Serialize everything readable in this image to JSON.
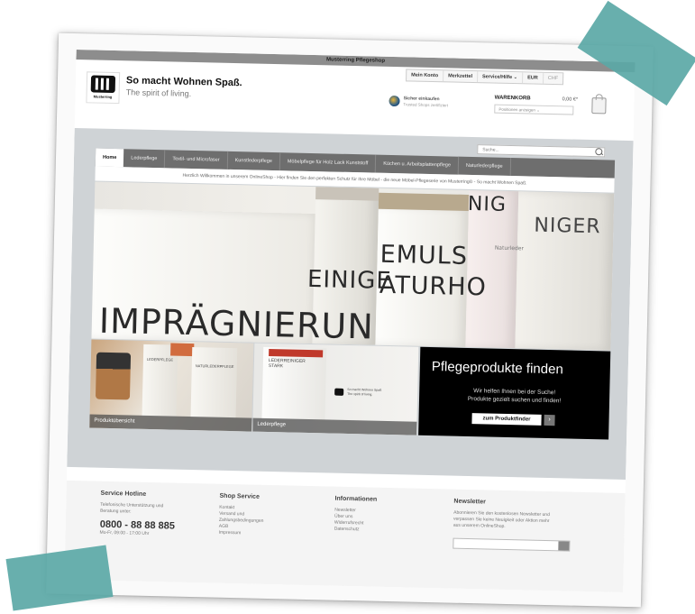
{
  "window": {
    "title": "Musterring Pflegeshop"
  },
  "brand": {
    "logo_text": "Musterring",
    "tagline_primary": "So macht Wohnen Spaß.",
    "tagline_secondary": "The spirit of living."
  },
  "top_links": [
    "Mein Konto",
    "Merkzettel",
    "Service/Hilfe ⌄",
    "EUR",
    "CHF"
  ],
  "trust": {
    "line1": "Sicher einkaufen",
    "line2": "Trusted Shops zertifiziert"
  },
  "cart": {
    "label": "WARENKORB",
    "amount": "0,00 €*",
    "select_text": "Positionen anzeigen ⌄"
  },
  "search": {
    "placeholder": "Suche..."
  },
  "nav": [
    "Home",
    "Lederpflege",
    "Textil- und Microfaser",
    "Kunstlederpflege",
    "Möbelpflege für Holz Lack Kunststoff",
    "Küchen u. Arbeitsplattenpflege",
    "Naturlederpflege"
  ],
  "welcome": "Herzlich Willkommen in unserem OnlineShop - Hier finden Sie den perfekten Schutz für Ihre Möbel - die neue Möbel-Pflegeserie von Musterring® - So macht Wohnen Spaß.",
  "hero_texts": {
    "impraeg": "IMPRÄGNIERUN",
    "reiniger_left": "EINIGE",
    "emuls": "EMULS",
    "naturho": "ATURHO",
    "niger_a": "NIG",
    "niger_b": "NIGER",
    "naturleder": "Naturleder"
  },
  "tiles": {
    "produktuebersicht": "Produktübersicht",
    "lederpflege": "Lederpflege",
    "tile1_label_a": "LEDERPFLEGE",
    "tile1_label_b": "NATURLEDERPFLEGE",
    "tile2_label": "LEDERREINIGER\nSTARK",
    "tile2_logo_text": "So macht Wohnen Spaß\nThe spirit of living.",
    "finder_title": "Pflegeprodukte finden",
    "finder_line1": "Wir helfen Ihnen bei der Suche!",
    "finder_line2": "Produkte gezielt suchen und finden!",
    "finder_button": "zum Produktfinder",
    "finder_arrow": "›"
  },
  "footer": {
    "hotline": {
      "title": "Service Hotline",
      "lines": [
        "Telefonische Unterstützung und",
        "Beratung unter:"
      ],
      "phone": "0800 - 88 88 885",
      "hours": "Mo-Fr, 09:00 - 17:00 Uhr"
    },
    "shop_service": {
      "title": "Shop Service",
      "links": [
        "Kontakt",
        "Versand und",
        "Zahlungsbedingungen",
        "AGB",
        "Impressum"
      ]
    },
    "informationen": {
      "title": "Informationen",
      "links": [
        "Newsletter",
        "Über uns",
        "Widerrufsrecht",
        "Datenschutz"
      ]
    },
    "newsletter": {
      "title": "Newsletter",
      "lines": [
        "Abonnieren Sie den kostenlosen Newsletter und",
        "verpassen Sie keine Neuigkeit oder Aktion mehr",
        "aus unserem OnlineShop."
      ]
    }
  }
}
